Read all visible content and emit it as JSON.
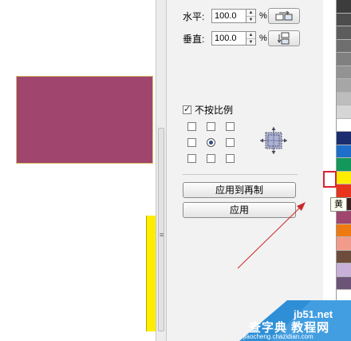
{
  "canvas": {
    "shape_colors": {
      "purple": "#a0456e",
      "yellow": "#ffee00"
    }
  },
  "scale": {
    "horizontal": {
      "label": "水平:",
      "value": "100.0",
      "unit": "%",
      "mirror_icon": "mirror-horizontal-icon"
    },
    "vertical": {
      "label": "垂直:",
      "value": "100.0",
      "unit": "%",
      "mirror_icon": "mirror-vertical-icon"
    }
  },
  "proportional": {
    "label": "不按比例",
    "checked": true
  },
  "anchor": {
    "selected": "center",
    "preview_icon": "anchor-preview-icon"
  },
  "buttons": {
    "apply_to_duplicate": "应用到再制",
    "apply": "应用"
  },
  "palette": {
    "colors": [
      "#3c3c3c",
      "#4d4d4d",
      "#5d5d5d",
      "#6e6e6e",
      "#808080",
      "#939393",
      "#a6a6a6",
      "#bdbdbd",
      "#d6d6d6",
      "#ffffff",
      "#1b2d6e",
      "#1d6fc9",
      "#12985b",
      "#ffee00",
      "#e8341c",
      "#3d1e1e",
      "#a0456e",
      "#f07a12",
      "#f39b8a",
      "#6e4c3c",
      "#c8b0d8",
      "#6c5478"
    ],
    "selected_index": 13,
    "tooltip": "黄"
  },
  "watermark": {
    "site": "jb51.net",
    "name": "查字典 教程网",
    "url": "jiaocheng.chazidian.com"
  }
}
